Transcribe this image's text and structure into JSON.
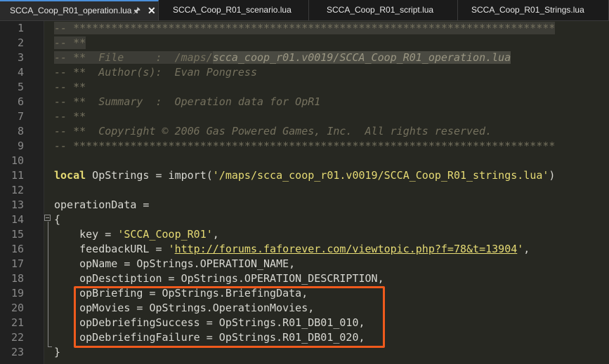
{
  "tabs": [
    {
      "label": "SCCA_Coop_R01_operation.lua",
      "active": true,
      "pin_icon": "pin-icon",
      "close_icon": "close-icon"
    },
    {
      "label": "SCCA_Coop_R01_scenario.lua",
      "active": false
    },
    {
      "label": "SCCA_Coop_R01_script.lua",
      "active": false
    },
    {
      "label": "SCCA_Coop_R01_Strings.lua",
      "active": false
    }
  ],
  "line_numbers": [
    "1",
    "2",
    "3",
    "4",
    "5",
    "6",
    "7",
    "8",
    "9",
    "10",
    "11",
    "12",
    "13",
    "14",
    "15",
    "16",
    "17",
    "18",
    "19",
    "20",
    "21",
    "22",
    "23"
  ],
  "code": {
    "l1": "-- ****************************************************************************",
    "l2": "-- **",
    "l3_a": "-- **  File     :  /maps/",
    "l3_b": "scca_coop_r01.v0019/SCCA_Coop_R01_operation.lua",
    "l4": "-- **  Author(s):  Evan Pongress",
    "l5": "-- **",
    "l6": "-- **  Summary  :  Operation data for OpR1",
    "l7": "-- **",
    "l8": "-- **  Copyright © 2006 Gas Powered Games, Inc.  All rights reserved.",
    "l9": "-- ****************************************************************************",
    "l11_kw": "local",
    "l11_a": " OpStrings = import(",
    "l11_str": "'/maps/scca_coop_r01.v0019/SCCA_Coop_R01_strings.lua'",
    "l11_b": ")",
    "l13": "operationData =",
    "l14": "{",
    "l15_a": "    key = ",
    "l15_str": "'SCCA_Coop_R01'",
    "l15_b": ",",
    "l16_a": "    feedbackURL = ",
    "l16_q1": "'",
    "l16_url": "http://forums.faforever.com/viewtopic.php?f=78&t=13904",
    "l16_q2": "'",
    "l16_b": ",",
    "l17": "    opName = OpStrings.OPERATION_NAME,",
    "l18": "    opDesctiption = OpStrings.OPERATION_DESCRIPTION,",
    "l19": "    opBriefing = OpStrings.BriefingData,",
    "l20": "    opMovies = OpStrings.OperationMovies,",
    "l21": "    opDebriefingSuccess = OpStrings.R01_DB01_010,",
    "l22": "    opDebriefingFailure = OpStrings.R01_DB01_020,",
    "l23": "}"
  },
  "colors": {
    "highlight_box": "#ef5a1c",
    "comment": "#75715e",
    "string": "#e6db74",
    "keyword": "#e6db74",
    "background": "#272822"
  }
}
